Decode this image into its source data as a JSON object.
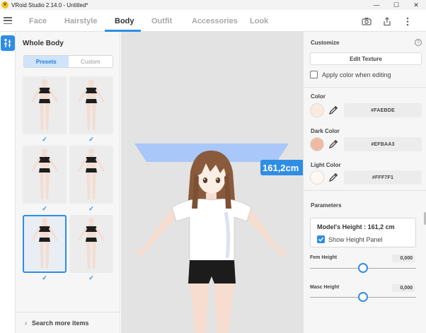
{
  "window": {
    "title": "VRoid Studio 2.14.0 - Untitled*",
    "controls": [
      "minimize-icon",
      "maximize-icon",
      "close-icon"
    ]
  },
  "topnav": {
    "tabs": [
      {
        "label": "Face",
        "active": false
      },
      {
        "label": "Hairstyle",
        "active": false
      },
      {
        "label": "Body",
        "active": true
      },
      {
        "label": "Outfit",
        "active": false
      },
      {
        "label": "Accessories",
        "active": false
      },
      {
        "label": "Look",
        "active": false
      }
    ],
    "icons": [
      "camera-icon",
      "export-icon",
      "more-vertical-icon"
    ]
  },
  "left_panel": {
    "title": "Whole Body",
    "segments": {
      "presets": "Presets",
      "custom": "Custom",
      "active": "Presets"
    },
    "presets": [
      {
        "check": "✓",
        "selected": false
      },
      {
        "check": "✓",
        "selected": false
      },
      {
        "check": "✓",
        "selected": false
      },
      {
        "check": "✓",
        "selected": false
      },
      {
        "check": "✓",
        "selected": true
      },
      {
        "check": "✓",
        "selected": false
      }
    ],
    "search_more": "Search more items"
  },
  "viewport": {
    "height_tag": "161,2cm"
  },
  "right_panel": {
    "customize_label": "Customize",
    "edit_texture": "Edit Texture",
    "apply_color_label": "Apply color when editing",
    "apply_color_checked": false,
    "colors": [
      {
        "label": "Color",
        "hex": "#FAEBDE"
      },
      {
        "label": "Dark Color",
        "hex": "#EFBAA3"
      },
      {
        "label": "Light Color",
        "hex": "#FFF7F1"
      }
    ],
    "parameters_label": "Parameters",
    "height_panel": {
      "title": "Model's Height : 161,2 cm",
      "show_label": "Show Height Panel",
      "show_checked": true
    },
    "sliders": [
      {
        "label": "Fem Height",
        "value": "0,000",
        "position": 0.5
      },
      {
        "label": "Masc Height",
        "value": "0,000",
        "position": 0.5
      }
    ]
  },
  "colors": {
    "accent": "#2F8DE4",
    "height_plane": "#A9C7F8",
    "skin": "#FAEBDE",
    "hair": "#8A5A3C"
  }
}
